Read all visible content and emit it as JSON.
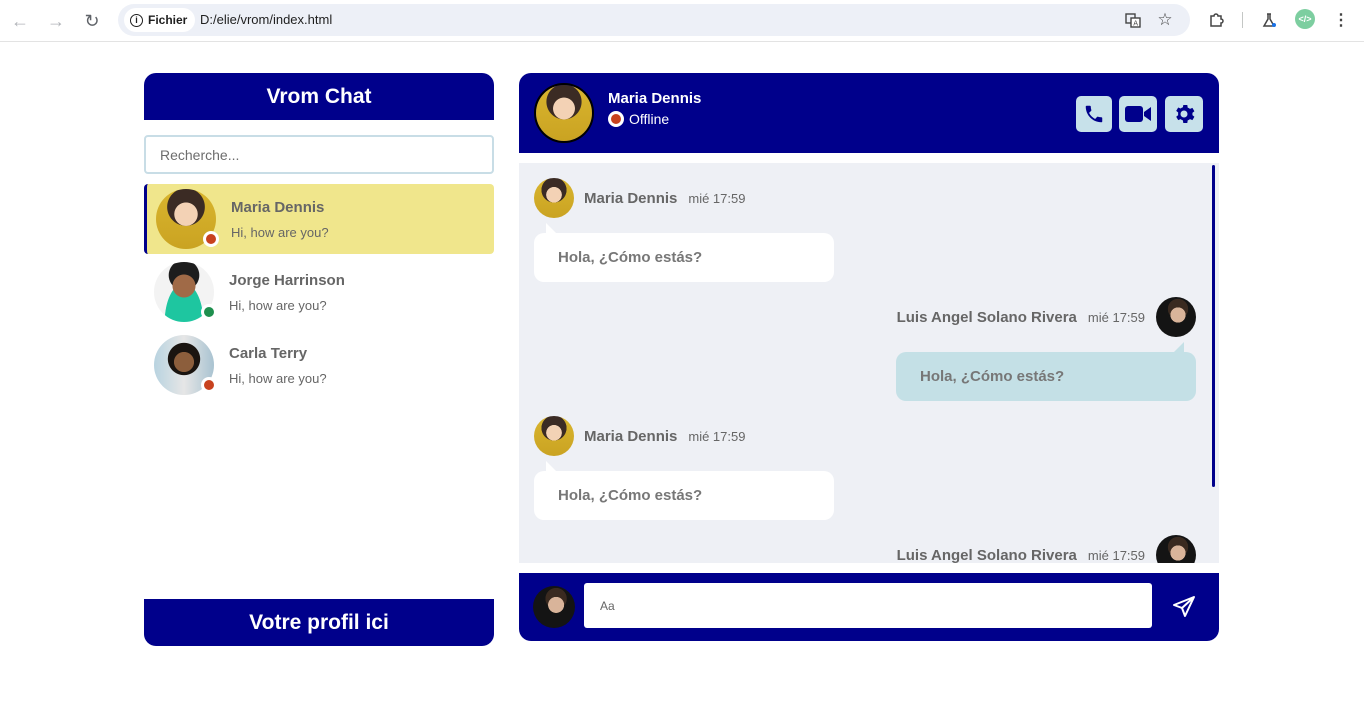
{
  "browser": {
    "site_chip": "Fichier",
    "url": "D:/elie/vrom/index.html"
  },
  "sidebar": {
    "title": "Vrom Chat",
    "search_placeholder": "Recherche...",
    "contacts": [
      {
        "name": "Maria Dennis",
        "preview": "Hi, how are you?",
        "status": "offline",
        "status_color": "#c8421e",
        "active": true
      },
      {
        "name": "Jorge Harrinson",
        "preview": "Hi, how are you?",
        "status": "online",
        "status_color": "#1e8f4e",
        "active": false
      },
      {
        "name": "Carla Terry",
        "preview": "Hi, how are you?",
        "status": "offline",
        "status_color": "#c8421e",
        "active": false
      }
    ],
    "footer": "Votre profil ici"
  },
  "chat": {
    "header": {
      "name": "Maria Dennis",
      "status": "Offline"
    },
    "messages": [
      {
        "side": "left",
        "name": "Maria Dennis",
        "time": "mié 17:59",
        "text": "Hola, ¿Cómo estás?"
      },
      {
        "side": "right",
        "name": "Luis Angel Solano Rivera",
        "time": "mié 17:59",
        "text": "Hola, ¿Cómo estás?"
      },
      {
        "side": "left",
        "name": "Maria Dennis",
        "time": "mié 17:59",
        "text": "Hola, ¿Cómo estás?"
      },
      {
        "side": "right",
        "name": "Luis Angel Solano Rivera",
        "time": "mié 17:59",
        "text": ""
      }
    ],
    "composer_placeholder": "Aa"
  },
  "colors": {
    "brand": "#00008b",
    "active_contact": "#f0e68c",
    "chat_bg": "#eef0f5",
    "own_bubble": "#c4e0e6",
    "button_bg": "#c7e1ea"
  }
}
